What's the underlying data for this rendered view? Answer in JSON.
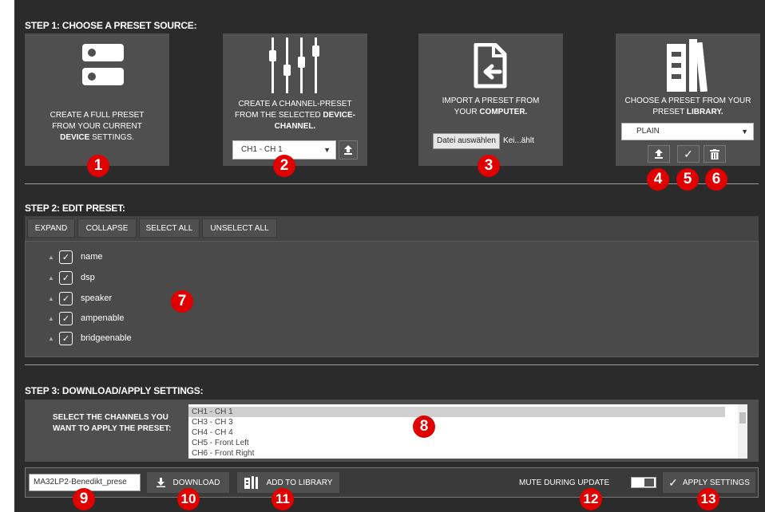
{
  "step1": {
    "title": "STEP 1: CHOOSE A PRESET SOURCE:",
    "device_card": {
      "text_pre": "CREATE A FULL PRESET FROM YOUR CURRENT ",
      "text_bold": "DEVICE",
      "text_post": " SETTINGS."
    },
    "channel_card": {
      "text_pre": "CREATE A CHANNEL-PRESET FROM THE SELECTED ",
      "text_bold": "DEVICE-CHANNEL.",
      "select_value": "CH1 - CH 1"
    },
    "import_card": {
      "text_pre": "IMPORT A PRESET FROM YOUR ",
      "text_bold": "COMPUTER.",
      "file_button": "Datei auswählen",
      "file_status": "Kei...ählt"
    },
    "library_card": {
      "text_pre": "CHOOSE A PRESET FROM YOUR PRESET ",
      "text_bold": "LIBRARY.",
      "select_value": "PLAIN"
    }
  },
  "step2": {
    "title": "STEP 2: EDIT PRESET:",
    "toolbar": {
      "expand": "EXPAND",
      "collapse": "COLLAPSE",
      "select_all": "SELECT ALL",
      "unselect_all": "UNSELECT ALL"
    },
    "tree_items": [
      "name",
      "dsp",
      "speaker",
      "ampenable",
      "bridgeenable"
    ]
  },
  "step3": {
    "title": "STEP 3: DOWNLOAD/APPLY SETTINGS:",
    "channels_label": "SELECT THE CHANNELS YOU WANT TO APPLY THE PRESET:",
    "channels": [
      "CH1 - CH 1",
      "CH3 - CH 3",
      "CH4 - CH 4",
      "CH5 - Front Left",
      "CH6 - Front Right"
    ],
    "filename_value": "MA32LP2-Benedikt_prese",
    "download": "DOWNLOAD",
    "add_to_library": "ADD TO LIBRARY",
    "mute_label": "MUTE DURING UPDATE",
    "apply": "APPLY SETTINGS"
  },
  "markers": [
    "1",
    "2",
    "3",
    "4",
    "5",
    "6",
    "7",
    "8",
    "9",
    "10",
    "11",
    "12",
    "13"
  ],
  "colors": {
    "background": "#2b2b2b",
    "card": "#4f4f4f",
    "marker": "#e00000"
  }
}
